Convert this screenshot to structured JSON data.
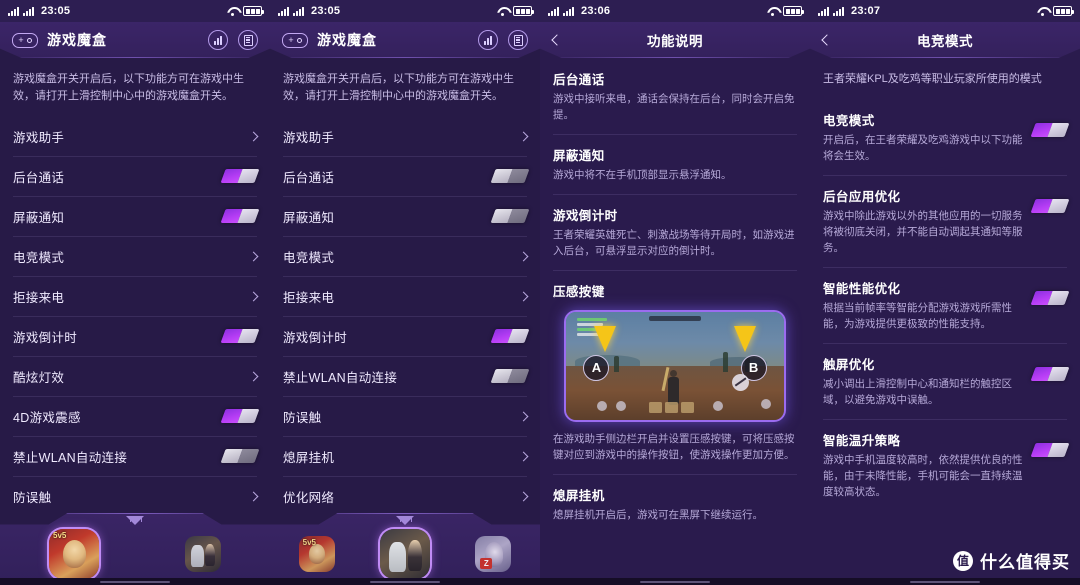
{
  "panels": [
    {
      "status": {
        "time": "23:05",
        "signal_icon": "signal-bars-icon",
        "wifi_icon": "wifi-icon",
        "battery_icon": "battery-icon"
      },
      "header": {
        "logo_icon": "gamepad-icon",
        "logo_plus": "+",
        "title": "游戏魔盒",
        "icon1": "stats-chart-icon",
        "icon2": "document-list-icon"
      },
      "intro": "游戏魔盒开关开启后，以下功能方可在游戏中生效，请打开上滑控制中心中的游戏魔盒开关。",
      "rows": [
        {
          "label": "游戏助手",
          "control": "chevron"
        },
        {
          "label": "后台通话",
          "control": "toggle",
          "state": "on"
        },
        {
          "label": "屏蔽通知",
          "control": "toggle",
          "state": "on"
        },
        {
          "label": "电竞模式",
          "control": "chevron"
        },
        {
          "label": "拒接来电",
          "control": "chevron"
        },
        {
          "label": "游戏倒计时",
          "control": "toggle",
          "state": "on"
        },
        {
          "label": "酷炫灯效",
          "control": "chevron"
        },
        {
          "label": "4D游戏震感",
          "control": "toggle",
          "state": "on"
        },
        {
          "label": "禁止WLAN自动连接",
          "control": "toggle",
          "state": "off"
        },
        {
          "label": "防误触",
          "control": "chevron"
        }
      ]
    },
    {
      "status": {
        "time": "23:05"
      },
      "header": {
        "logo_plus": "+",
        "title": "游戏魔盒"
      },
      "intro": "游戏魔盒开关开启后，以下功能方可在游戏中生效，请打开上滑控制中心中的游戏魔盒开关。",
      "rows": [
        {
          "label": "游戏助手",
          "control": "chevron"
        },
        {
          "label": "后台通话",
          "control": "toggle",
          "state": "off"
        },
        {
          "label": "屏蔽通知",
          "control": "toggle",
          "state": "off"
        },
        {
          "label": "电竞模式",
          "control": "chevron"
        },
        {
          "label": "拒接来电",
          "control": "chevron"
        },
        {
          "label": "游戏倒计时",
          "control": "toggle",
          "state": "on"
        },
        {
          "label": "禁止WLAN自动连接",
          "control": "toggle",
          "state": "off"
        },
        {
          "label": "防误触",
          "control": "chevron"
        },
        {
          "label": "熄屏挂机",
          "control": "chevron"
        },
        {
          "label": "优化网络",
          "control": "chevron"
        }
      ]
    },
    {
      "status": {
        "time": "23:06"
      },
      "header": {
        "back_icon": "back-chevron-icon",
        "title": "功能说明"
      },
      "sections": [
        {
          "title": "后台通话",
          "body": "游戏中接听来电，通话会保持在后台，同时会开启免提。"
        },
        {
          "title": "屏蔽通知",
          "body": "游戏中将不在手机顶部显示悬浮通知。"
        },
        {
          "title": "游戏倒计时",
          "body": "王者荣耀英雄死亡、刺激战场等待开局时，如游戏进入后台，可悬浮显示对应的倒计时。"
        },
        {
          "title": "压感按键",
          "body": "在游戏助手侧边栏开启并设置压感按键，可将压感按键对应到游戏中的操作按钮，使游戏操作更加方便。",
          "image": "pressure-key-demo-screenshot",
          "button_a": "A",
          "button_b": "B"
        },
        {
          "title": "熄屏挂机",
          "body": "熄屏挂机开启后，游戏可在黑屏下继续运行。"
        }
      ]
    },
    {
      "status": {
        "time": "23:07"
      },
      "header": {
        "back_icon": "back-chevron-icon",
        "title": "电竞模式"
      },
      "intro": "王者荣耀KPL及吃鸡等职业玩家所使用的模式",
      "sections": [
        {
          "title": "电竞模式",
          "body": "开启后，在王者荣耀及吃鸡游戏中以下功能将会生效。",
          "state": "on"
        },
        {
          "title": "后台应用优化",
          "body": "游戏中除此游戏以外的其他应用的一切服务将被彻底关闭，并不能自动调起其通知等服务。",
          "state": "on"
        },
        {
          "title": "智能性能优化",
          "body": "根据当前帧率等智能分配游戏游戏所需性能，为游戏提供更极致的性能支持。",
          "state": "on"
        },
        {
          "title": "触屏优化",
          "body": "减小调出上滑控制中心和通知栏的触控区域，以避免游戏中误触。",
          "state": "on"
        },
        {
          "title": "智能温升策略",
          "body": "游戏中手机温度较高时，依然提供优良的性能，由于未降性能，手机可能会一直持续温度较高状态。",
          "state": "on"
        }
      ]
    }
  ],
  "dock": {
    "arrow_icon": "dock-expand-arrow-icon",
    "games": [
      {
        "name": "honor-of-kings-icon",
        "selected": true
      },
      {
        "name": "pubg-mobile-icon",
        "selected": false
      }
    ]
  },
  "watermark": {
    "badge": "值",
    "text": "什么值得买"
  },
  "colors": {
    "accent": "#b63df5",
    "bg": "#271a47",
    "header": "#3b2568",
    "text": "#f0eaff",
    "muted": "#b6a9d8"
  }
}
